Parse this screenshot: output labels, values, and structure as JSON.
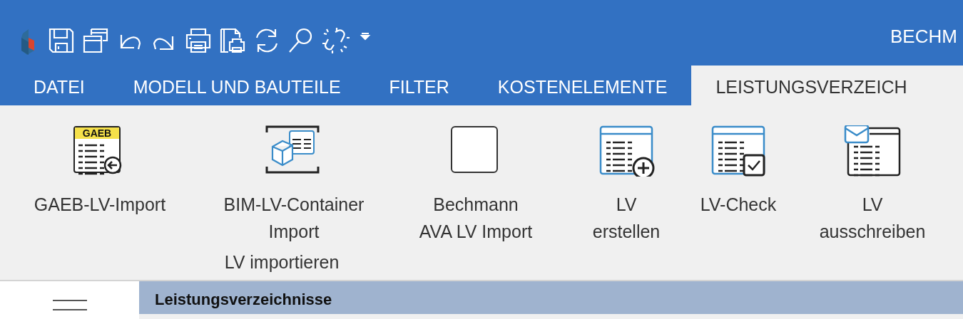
{
  "window": {
    "title": "BECHM"
  },
  "tabs": [
    {
      "label": "DATEI",
      "selected": false
    },
    {
      "label": "MODELL UND BAUTEILE",
      "selected": false
    },
    {
      "label": "FILTER",
      "selected": false
    },
    {
      "label": "KOSTENELEMENTE",
      "selected": false
    },
    {
      "label": "LEISTUNGSVERZEICH",
      "selected": true
    }
  ],
  "ribbon_groups": [
    {
      "label": "LV importieren",
      "buttons": [
        {
          "label": "GAEB-LV-Import",
          "badge": "GAEB"
        },
        {
          "label": "BIM-LV-Container\nImport"
        },
        {
          "label": "Bechmann\nAVA LV Import"
        }
      ]
    },
    {
      "buttons": [
        {
          "label": "LV\nerstellen"
        },
        {
          "label": "LV-Check"
        },
        {
          "label": "LV\nausschreiben"
        }
      ]
    }
  ],
  "panel": {
    "title": "Leistungsverzeichnisse"
  }
}
